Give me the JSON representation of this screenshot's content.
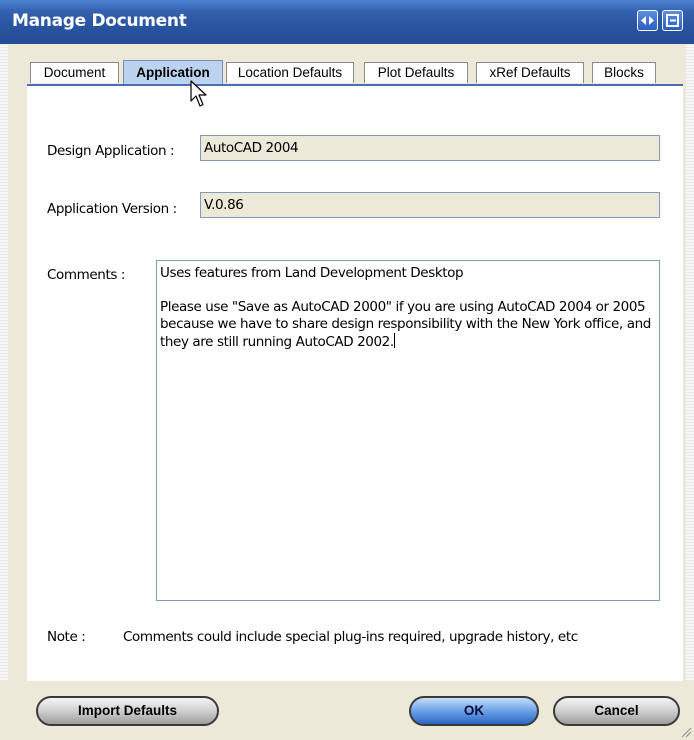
{
  "window": {
    "title": "Manage Document"
  },
  "tabs": [
    {
      "label": "Document"
    },
    {
      "label": "Application",
      "active": true
    },
    {
      "label": "Location Defaults"
    },
    {
      "label": "Plot Defaults"
    },
    {
      "label": "xRef Defaults"
    },
    {
      "label": "Blocks"
    }
  ],
  "form": {
    "design_app_label": "Design Application :",
    "design_app_value": "AutoCAD 2004",
    "app_version_label": "Application Version :",
    "app_version_value": "V.0.86",
    "comments_label": "Comments :",
    "comments_value": "Uses features from Land Development Desktop\n\nPlease use \"Save as AutoCAD 2000\" if you are using AutoCAD 2004 or 2005 because we have to share design responsibility with the New York office, and they are still running AutoCAD 2002.",
    "note_label": "Note :",
    "note_text": "Comments could include special plug-ins required, upgrade history, etc"
  },
  "buttons": {
    "import_defaults": "Import Defaults",
    "ok": "OK",
    "cancel": "Cancel"
  },
  "icons": {
    "titlebar_left": "collapse-arrows-icon",
    "titlebar_right": "restore-window-icon",
    "cursor": "mouse-pointer-icon",
    "resize": "resize-grip-icon"
  },
  "colors": {
    "titlebar": "#2a55a2",
    "active_tab": "#bcd3f0",
    "ok_button": "#6aa1e6"
  }
}
